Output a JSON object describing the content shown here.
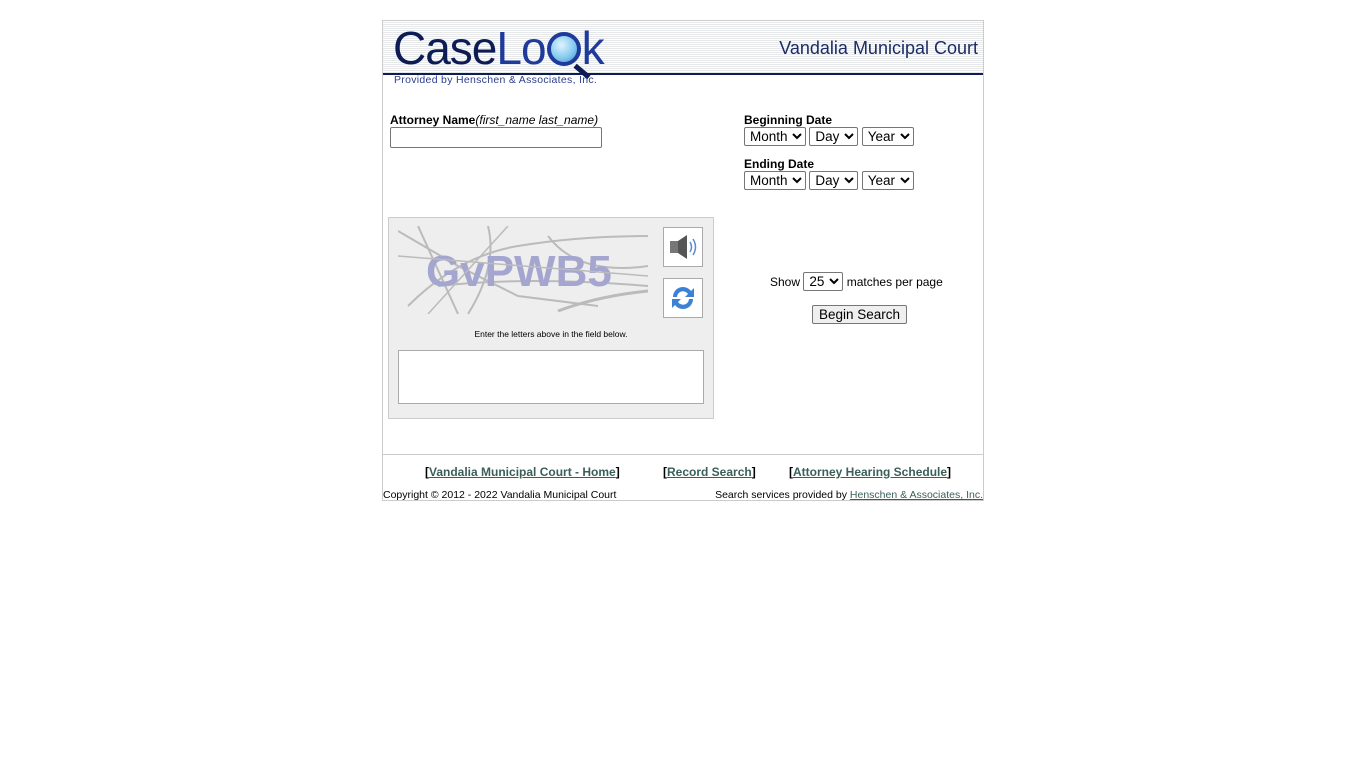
{
  "header": {
    "logo_case": "Case",
    "logo_l": "L",
    "logo_ok": "ok",
    "logo_text": "CaseLook",
    "court": "Vandalia Municipal Court",
    "provided": "Provided by Henschen & Associates, Inc."
  },
  "form": {
    "attorney_label": "Attorney Name",
    "attorney_hint": "(first_name last_name)",
    "attorney_value": "",
    "begin_label": "Beginning Date",
    "end_label": "Ending Date",
    "month": "Month",
    "day": "Day",
    "year": "Year",
    "show": "Show",
    "per_page": "25",
    "matches": "matches per page",
    "search_button": "Begin Search"
  },
  "captcha": {
    "text": "GvPWB5",
    "note": "Enter the letters above in the field below.",
    "value": "",
    "audio_icon": "speaker-icon",
    "refresh_icon": "refresh-icon"
  },
  "footer": {
    "links": [
      "Vandalia Municipal Court - Home",
      "Record Search",
      "Attorney Hearing Schedule"
    ],
    "copyright": "Copyright © 2012 - 2022 Vandalia Municipal Court",
    "provided_by": "Search services provided by",
    "provider_link": "Henschen & Associates, Inc."
  },
  "colors": {
    "navy": "#0d1c55",
    "link": "#3a5f5a",
    "captcha_text": "#a4a6cf"
  }
}
